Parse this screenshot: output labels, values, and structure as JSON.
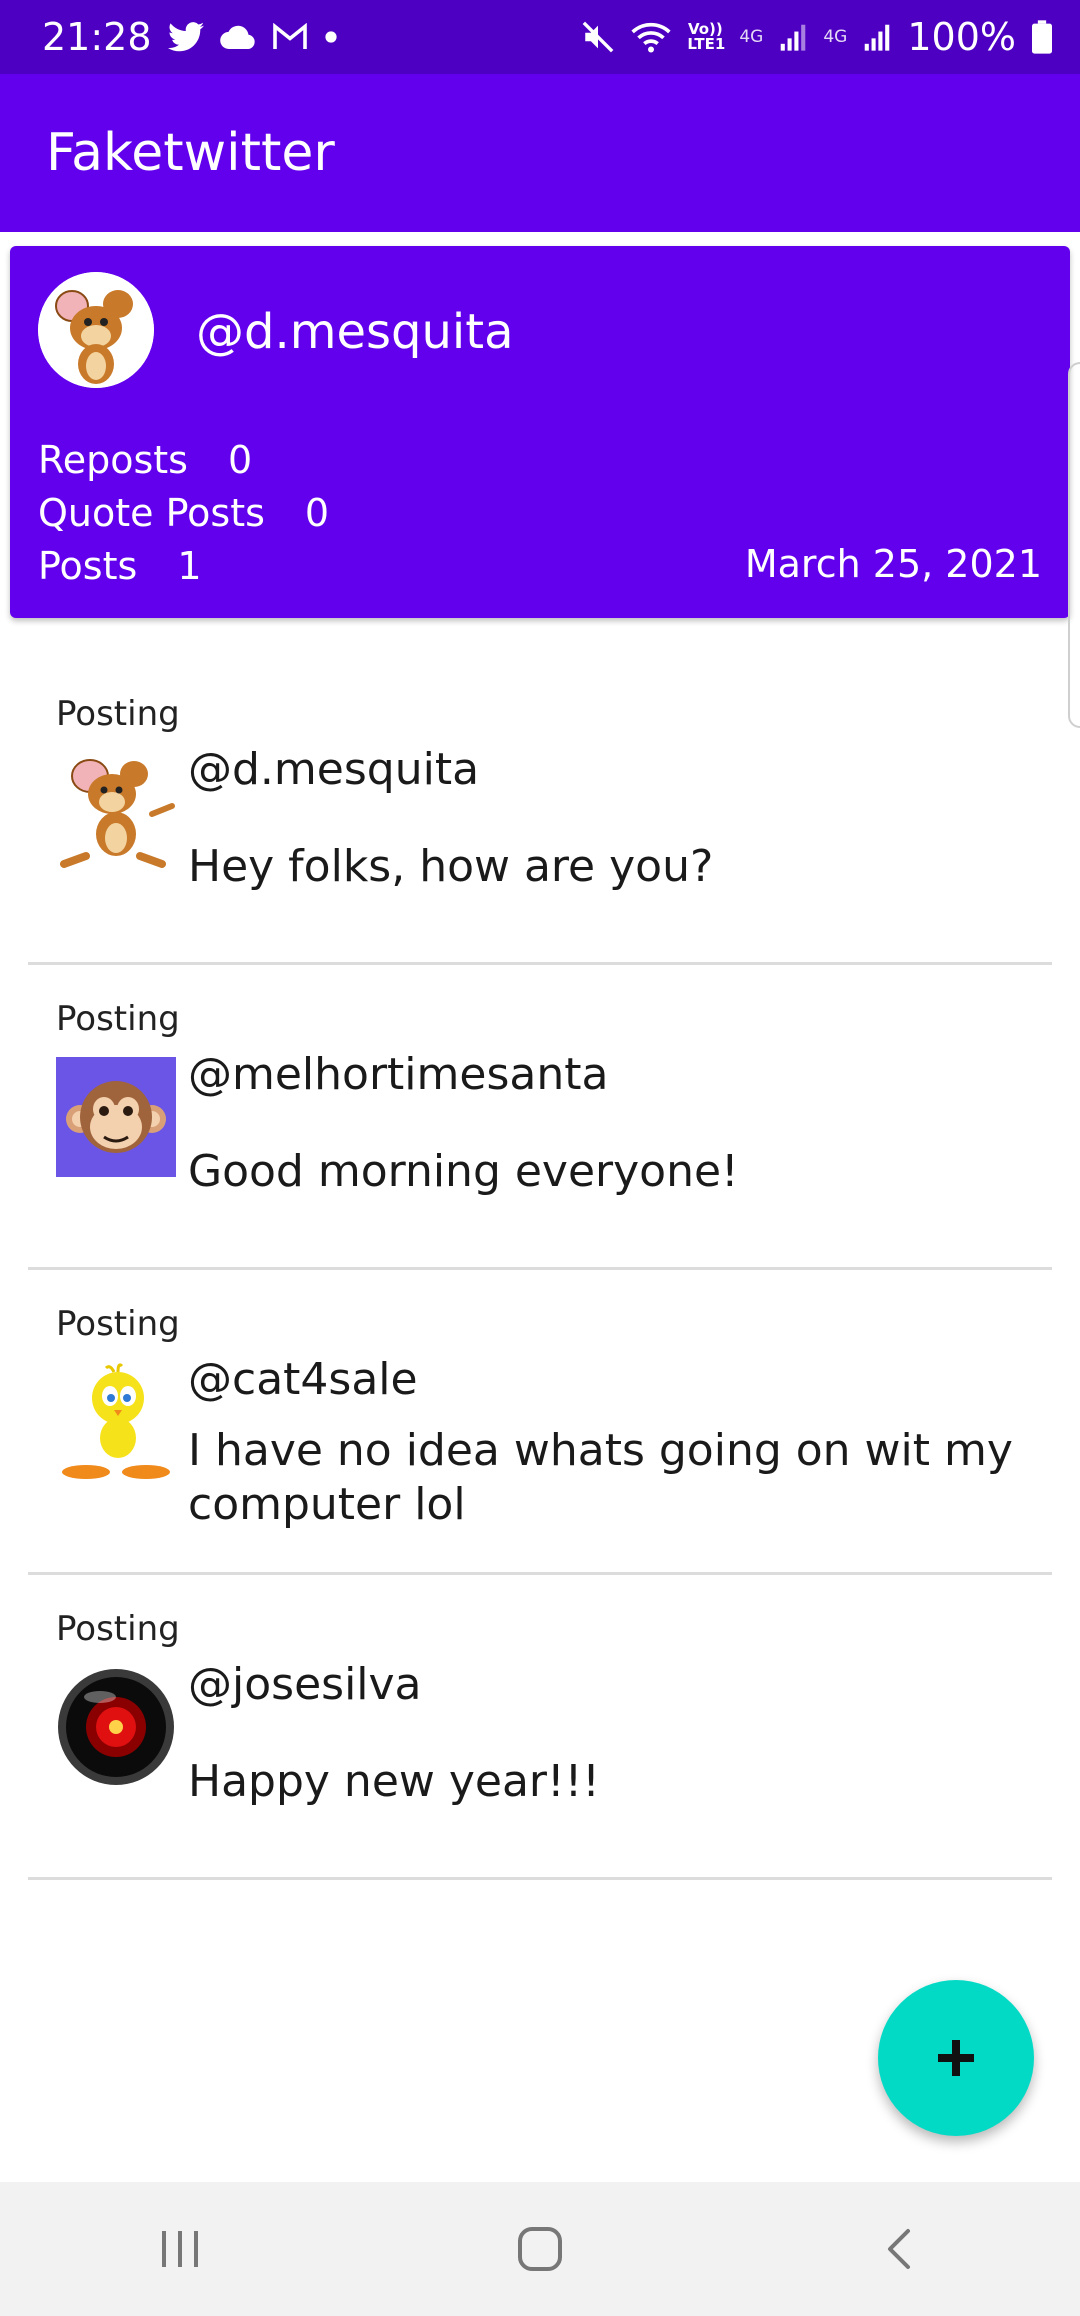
{
  "status_bar": {
    "time": "21:28",
    "notification_icons": [
      "twitter-icon",
      "cloud-icon",
      "gmail-icon",
      "dot-icon"
    ],
    "system_icons": [
      "mute-icon",
      "wifi-icon",
      "volte-icon",
      "signal-icon",
      "signal-icon"
    ],
    "network_label_1": "Vo)) LTE1",
    "network_label_2": "4G",
    "network_label_3": "4G",
    "battery": "100%"
  },
  "app_bar": {
    "title": "Faketwitter"
  },
  "profile": {
    "handle": "@d.mesquita",
    "reposts_label": "Reposts",
    "reposts_value": "0",
    "quote_posts_label": "Quote Posts",
    "quote_posts_value": "0",
    "posts_label": "Posts",
    "posts_value": "1",
    "date": "March 25, 2021"
  },
  "feed": [
    {
      "type": "Posting",
      "handle": "@d.mesquita",
      "text": "Hey folks, how are you?",
      "avatar": "mouse-avatar"
    },
    {
      "type": "Posting",
      "handle": "@melhortimesanta",
      "text": "Good morning everyone!",
      "avatar": "monkey-avatar"
    },
    {
      "type": "Posting",
      "handle": "@cat4sale",
      "text": "I have no idea whats going on wit my computer lol",
      "avatar": "bird-avatar"
    },
    {
      "type": "Posting",
      "handle": "@josesilva",
      "text": "Happy new year!!!",
      "avatar": "red-eye-avatar"
    }
  ],
  "colors": {
    "primary": "#6200ee",
    "status_bar": "#4e00c2",
    "fab": "#03dac5"
  },
  "fab": {
    "icon": "plus-icon"
  },
  "nav_bar": {
    "icons": [
      "recent-apps-icon",
      "home-icon",
      "back-icon"
    ]
  }
}
